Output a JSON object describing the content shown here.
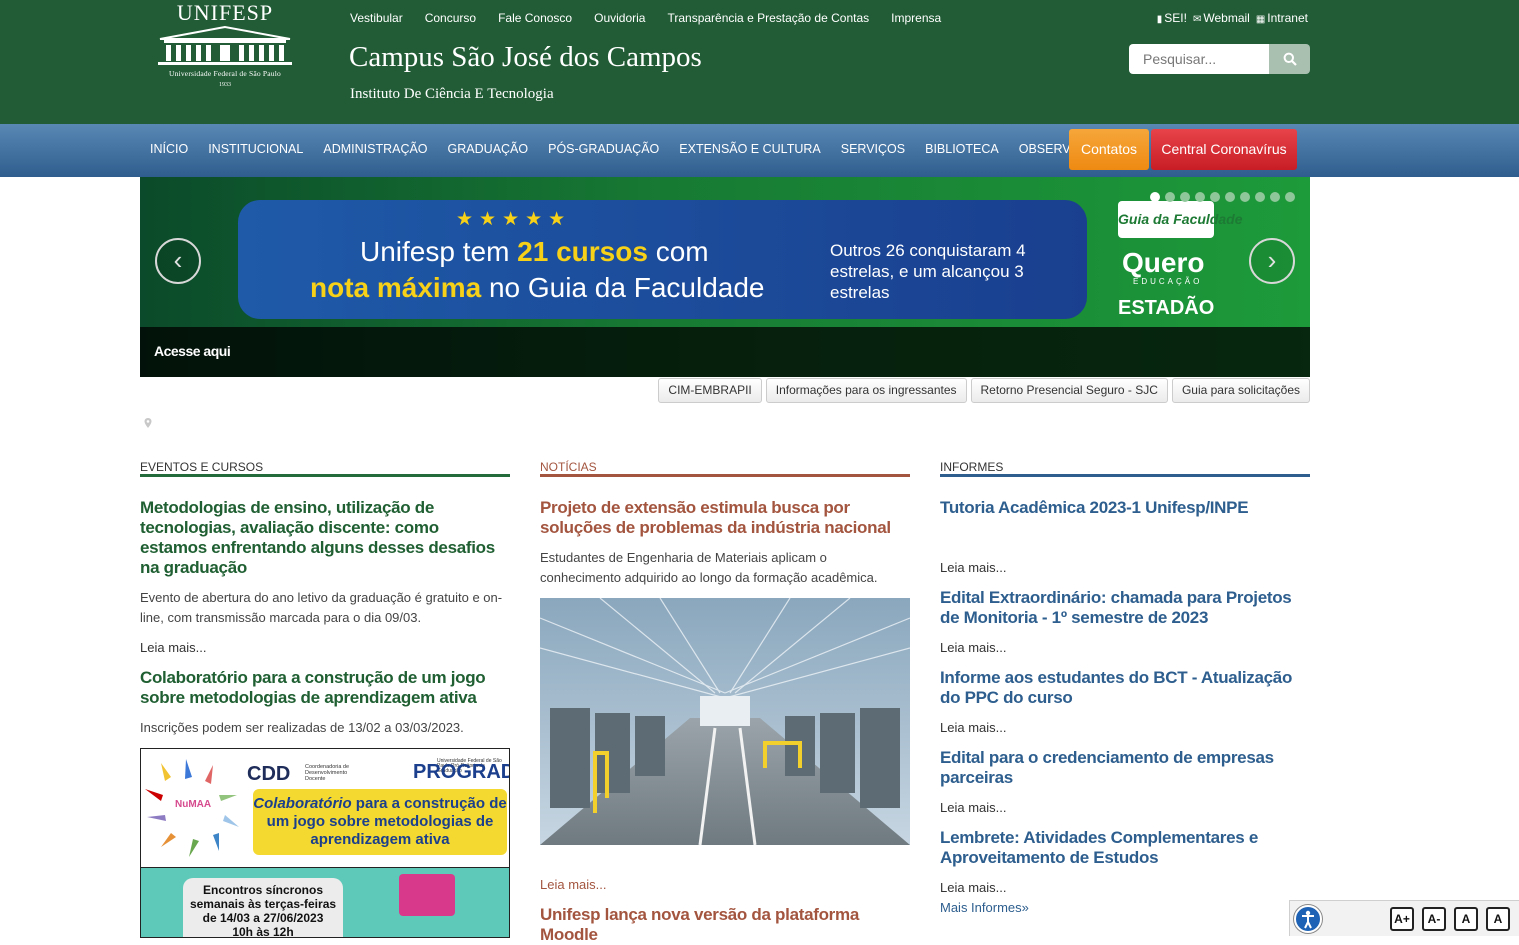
{
  "header": {
    "logo": {
      "title": "UNIFESP",
      "subtitle": "Universidade Federal de São Paulo",
      "year": "1933"
    },
    "top_links": [
      "Vestibular",
      "Concurso",
      "Fale Conosco",
      "Ouvidoria",
      "Transparência e Prestação de Contas",
      "Imprensa"
    ],
    "util_links": [
      {
        "icon": "file-icon",
        "label": "SEI!"
      },
      {
        "icon": "envelope-icon",
        "label": "Webmail"
      },
      {
        "icon": "grid-icon",
        "label": "Intranet"
      }
    ],
    "campus_title": "Campus São José dos Campos",
    "campus_subtitle": "Instituto De Ciência E Tecnologia",
    "search": {
      "placeholder": "Pesquisar...",
      "icon": "search-icon"
    }
  },
  "nav": {
    "items": [
      "INÍCIO",
      "INSTITUCIONAL",
      "ADMINISTRAÇÃO",
      "GRADUAÇÃO",
      "PÓS-GRADUAÇÃO",
      "EXTENSÃO E CULTURA",
      "SERVIÇOS",
      "BIBLIOTECA",
      "OBSERVATÓRIO"
    ],
    "contatos": "Contatos",
    "coronavirus": "Central Coronavírus",
    "colors": {
      "bar": "#3f6e9e",
      "contatos": "#f39a1f",
      "coronavirus": "#d8262e"
    }
  },
  "banner": {
    "stars": "★★★★★",
    "line1_pre": "Unifesp tem ",
    "line1_highlight": "21 cursos",
    "line1_post": " com",
    "line2_highlight": "nota máxima",
    "line2_post": " no Guia da Faculdade",
    "side_text": "Outros 26 conquistaram 4 estrelas, e um alcançou 3 estrelas",
    "brand_guia": "Guia da Faculdade",
    "brand_quero": "Quero",
    "brand_quero_sub": "EDUCAÇÃO",
    "brand_estadao": "ESTADÃO",
    "caption": "Acesse aqui",
    "prev_icon": "‹",
    "next_icon": "›",
    "slide_count": 10,
    "active_slide": 1
  },
  "quick_tabs": [
    "CIM-EMBRAPII",
    "Informações para os ingressantes",
    "Retorno Presencial Seguro - SJC",
    "Guia para solicitações"
  ],
  "eventos": {
    "title": "EVENTOS E CURSOS",
    "items": [
      {
        "title": "Metodologias de ensino, utilização de tecnologias, avaliação discente: como estamos enfrentando alguns desses desafios na graduação",
        "desc": "Evento de abertura do ano letivo da graduação é gratuito e on-line, com transmissão marcada para o dia 09/03.",
        "more": "Leia mais..."
      },
      {
        "title": "Colaboratório para a construção de um jogo sobre metodologias de aprendizagem ativa",
        "desc": "Inscrições podem ser realizadas de 13/02 a 03/03/2023."
      }
    ],
    "promo": {
      "cdd": "CDD",
      "cdd_sub": "Coordenadoria de Desenvolvimento Docente",
      "prograd": "PROGRAD",
      "prograd_sub": "Universidade Federal de São Paulo Pró-Reitoria de Graduação",
      "numa": "NuMAA",
      "headline_em": "Colaboratório",
      "headline": " para a construção de um jogo sobre metodologias de aprendizagem ativa",
      "card_line1": "Encontros síncronos",
      "card_line2": "semanais às terças-feiras",
      "card_line3": "de  14/03 a 27/06/2023",
      "card_line4": "10h às 12h"
    }
  },
  "noticias": {
    "title": "NOTÍCIAS",
    "items": [
      {
        "title": "Projeto de extensão estimula busca por soluções de problemas da indústria nacional",
        "desc": "Estudantes de Engenharia de Materiais aplicam o conhecimento adquirido ao longo da formação acadêmica.",
        "more": "Leia mais..."
      },
      {
        "title": "Unifesp lança nova versão da plataforma Moodle"
      }
    ]
  },
  "informes": {
    "title": "INFORMES",
    "items": [
      {
        "title": "Tutoria Acadêmica 2023-1 Unifesp/INPE",
        "more": "Leia mais..."
      },
      {
        "title": "Edital Extraordinário: chamada para Projetos de Monitoria - 1º semestre de 2023",
        "more": "Leia mais..."
      },
      {
        "title": "Informe aos estudantes do BCT - Atualização do PPC do curso",
        "more": "Leia mais..."
      },
      {
        "title": "Edital para o credenciamento de empresas parceiras",
        "more": "Leia mais..."
      },
      {
        "title": "Lembrete: Atividades Complementares e Aproveitamento de Estudos",
        "more": "Leia mais..."
      }
    ],
    "all": "Mais Informes»"
  },
  "accessibility": {
    "buttons": [
      "A+",
      "A-",
      "A",
      "A"
    ],
    "icon": "accessibility-icon"
  }
}
